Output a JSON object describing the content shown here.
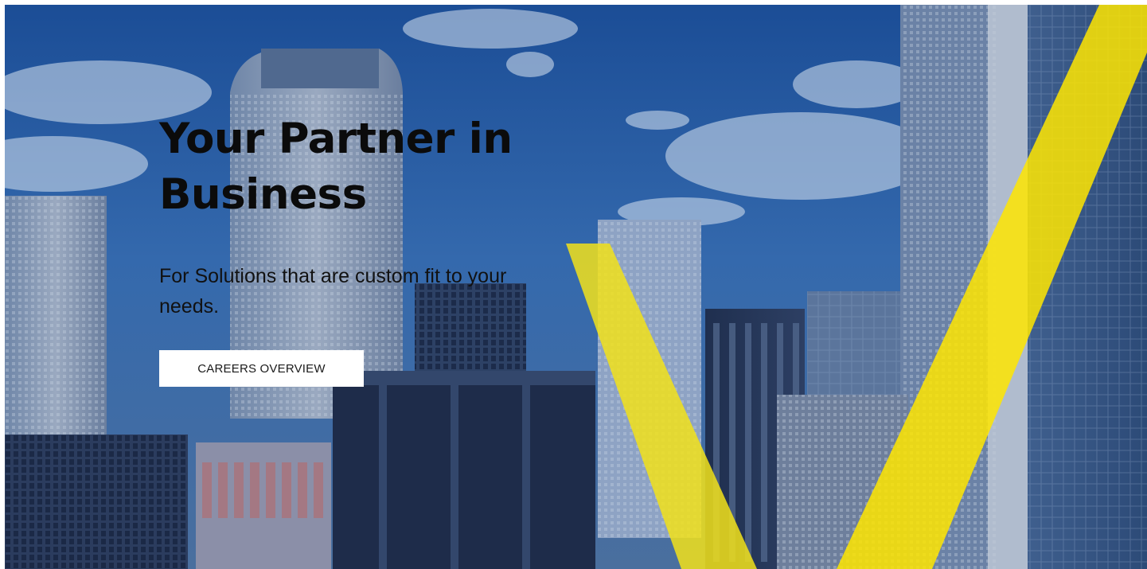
{
  "hero": {
    "title_line1": "Your Partner in",
    "title_line2": "Business",
    "subtitle": "For Solutions that are custom fit to your needs.",
    "cta_label": "CAREERS OVERVIEW"
  },
  "colors": {
    "accent_yellow": "#ffe600",
    "sky_blue": "#1f4f95",
    "button_bg": "#ffffff",
    "title_text": "#0b0b0b"
  }
}
